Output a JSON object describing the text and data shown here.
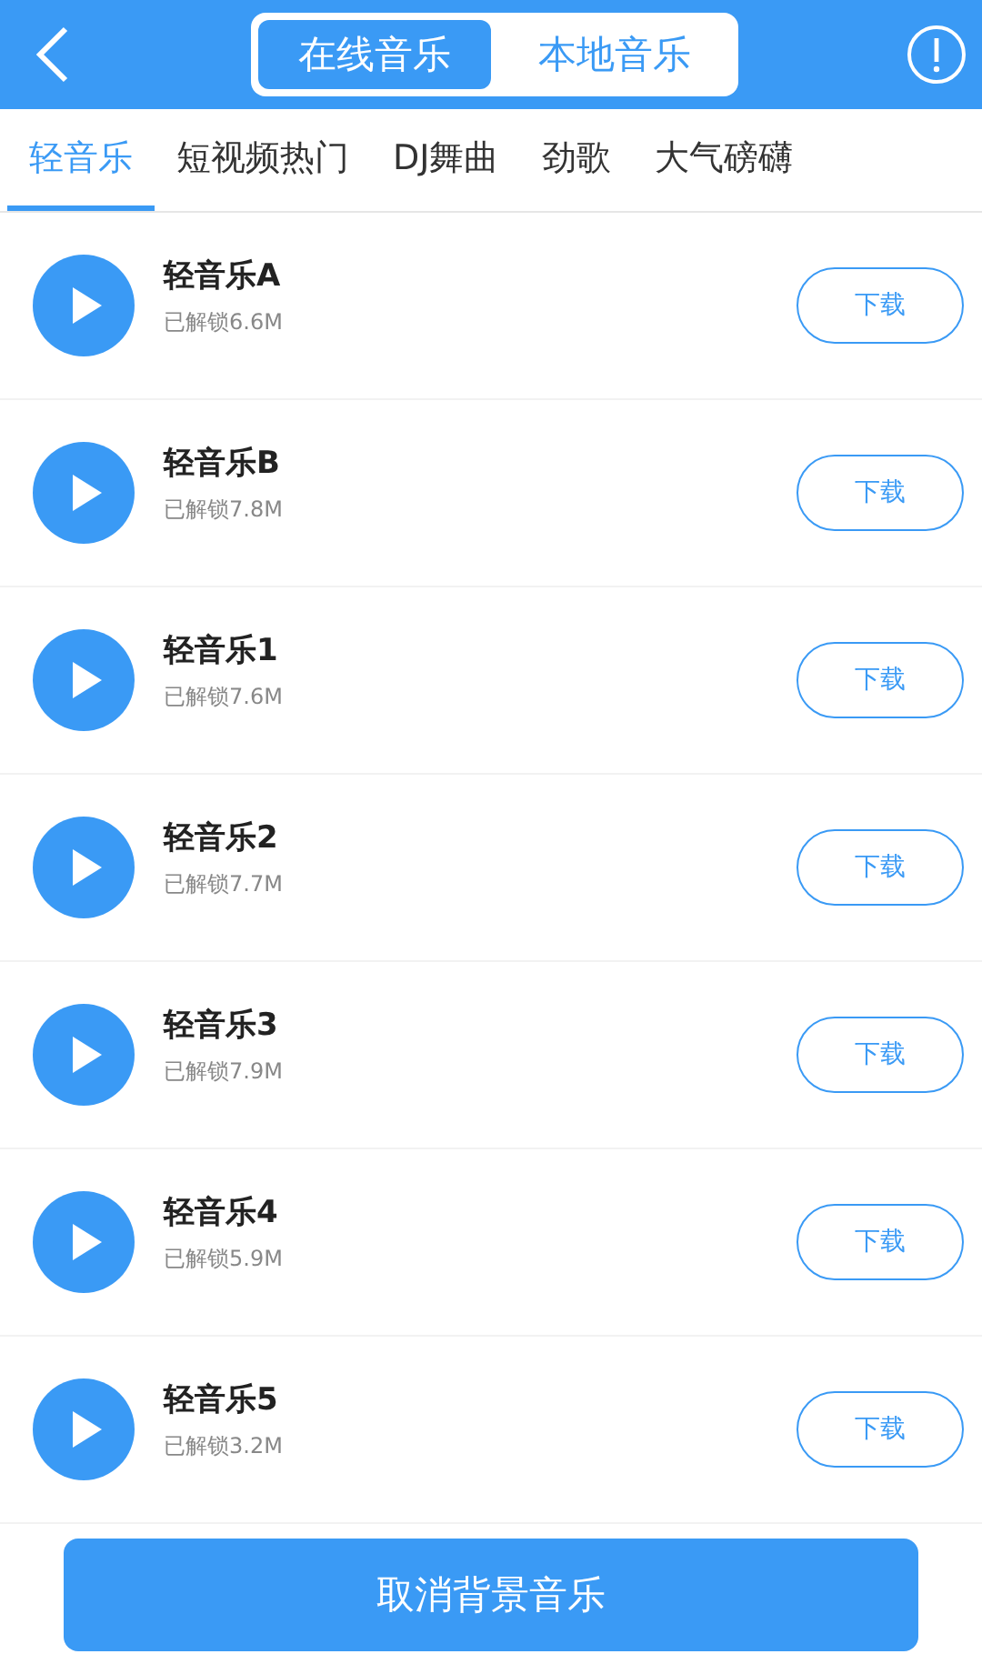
{
  "header": {
    "segments": [
      {
        "label": "在线音乐",
        "selected": true
      },
      {
        "label": "本地音乐",
        "selected": false
      }
    ]
  },
  "categories": [
    {
      "label": "轻音乐",
      "selected": true
    },
    {
      "label": "短视频热门",
      "selected": false
    },
    {
      "label": "DJ舞曲",
      "selected": false
    },
    {
      "label": "劲歌",
      "selected": false
    },
    {
      "label": "大气磅礴",
      "selected": false
    }
  ],
  "tracks": [
    {
      "title": "轻音乐A",
      "info": "已解锁6.6M",
      "action": "下载"
    },
    {
      "title": "轻音乐B",
      "info": "已解锁7.8M",
      "action": "下载"
    },
    {
      "title": "轻音乐1",
      "info": "已解锁7.6M",
      "action": "下载"
    },
    {
      "title": "轻音乐2",
      "info": "已解锁7.7M",
      "action": "下载"
    },
    {
      "title": "轻音乐3",
      "info": "已解锁7.9M",
      "action": "下载"
    },
    {
      "title": "轻音乐4",
      "info": "已解锁5.9M",
      "action": "下载"
    },
    {
      "title": "轻音乐5",
      "info": "已解锁3.2M",
      "action": "下载"
    }
  ],
  "footer_button": "取消背景音乐"
}
